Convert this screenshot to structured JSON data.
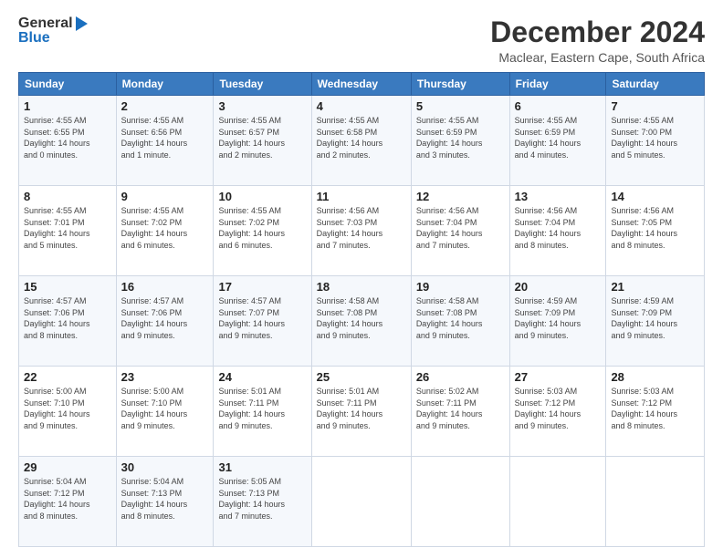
{
  "header": {
    "logo_general": "General",
    "logo_blue": "Blue",
    "main_title": "December 2024",
    "subtitle": "Maclear, Eastern Cape, South Africa"
  },
  "calendar": {
    "days_of_week": [
      "Sunday",
      "Monday",
      "Tuesday",
      "Wednesday",
      "Thursday",
      "Friday",
      "Saturday"
    ],
    "weeks": [
      [
        {
          "day": "1",
          "info": "Sunrise: 4:55 AM\nSunset: 6:55 PM\nDaylight: 14 hours\nand 0 minutes."
        },
        {
          "day": "2",
          "info": "Sunrise: 4:55 AM\nSunset: 6:56 PM\nDaylight: 14 hours\nand 1 minute."
        },
        {
          "day": "3",
          "info": "Sunrise: 4:55 AM\nSunset: 6:57 PM\nDaylight: 14 hours\nand 2 minutes."
        },
        {
          "day": "4",
          "info": "Sunrise: 4:55 AM\nSunset: 6:58 PM\nDaylight: 14 hours\nand 2 minutes."
        },
        {
          "day": "5",
          "info": "Sunrise: 4:55 AM\nSunset: 6:59 PM\nDaylight: 14 hours\nand 3 minutes."
        },
        {
          "day": "6",
          "info": "Sunrise: 4:55 AM\nSunset: 6:59 PM\nDaylight: 14 hours\nand 4 minutes."
        },
        {
          "day": "7",
          "info": "Sunrise: 4:55 AM\nSunset: 7:00 PM\nDaylight: 14 hours\nand 5 minutes."
        }
      ],
      [
        {
          "day": "8",
          "info": "Sunrise: 4:55 AM\nSunset: 7:01 PM\nDaylight: 14 hours\nand 5 minutes."
        },
        {
          "day": "9",
          "info": "Sunrise: 4:55 AM\nSunset: 7:02 PM\nDaylight: 14 hours\nand 6 minutes."
        },
        {
          "day": "10",
          "info": "Sunrise: 4:55 AM\nSunset: 7:02 PM\nDaylight: 14 hours\nand 6 minutes."
        },
        {
          "day": "11",
          "info": "Sunrise: 4:56 AM\nSunset: 7:03 PM\nDaylight: 14 hours\nand 7 minutes."
        },
        {
          "day": "12",
          "info": "Sunrise: 4:56 AM\nSunset: 7:04 PM\nDaylight: 14 hours\nand 7 minutes."
        },
        {
          "day": "13",
          "info": "Sunrise: 4:56 AM\nSunset: 7:04 PM\nDaylight: 14 hours\nand 8 minutes."
        },
        {
          "day": "14",
          "info": "Sunrise: 4:56 AM\nSunset: 7:05 PM\nDaylight: 14 hours\nand 8 minutes."
        }
      ],
      [
        {
          "day": "15",
          "info": "Sunrise: 4:57 AM\nSunset: 7:06 PM\nDaylight: 14 hours\nand 8 minutes."
        },
        {
          "day": "16",
          "info": "Sunrise: 4:57 AM\nSunset: 7:06 PM\nDaylight: 14 hours\nand 9 minutes."
        },
        {
          "day": "17",
          "info": "Sunrise: 4:57 AM\nSunset: 7:07 PM\nDaylight: 14 hours\nand 9 minutes."
        },
        {
          "day": "18",
          "info": "Sunrise: 4:58 AM\nSunset: 7:08 PM\nDaylight: 14 hours\nand 9 minutes."
        },
        {
          "day": "19",
          "info": "Sunrise: 4:58 AM\nSunset: 7:08 PM\nDaylight: 14 hours\nand 9 minutes."
        },
        {
          "day": "20",
          "info": "Sunrise: 4:59 AM\nSunset: 7:09 PM\nDaylight: 14 hours\nand 9 minutes."
        },
        {
          "day": "21",
          "info": "Sunrise: 4:59 AM\nSunset: 7:09 PM\nDaylight: 14 hours\nand 9 minutes."
        }
      ],
      [
        {
          "day": "22",
          "info": "Sunrise: 5:00 AM\nSunset: 7:10 PM\nDaylight: 14 hours\nand 9 minutes."
        },
        {
          "day": "23",
          "info": "Sunrise: 5:00 AM\nSunset: 7:10 PM\nDaylight: 14 hours\nand 9 minutes."
        },
        {
          "day": "24",
          "info": "Sunrise: 5:01 AM\nSunset: 7:11 PM\nDaylight: 14 hours\nand 9 minutes."
        },
        {
          "day": "25",
          "info": "Sunrise: 5:01 AM\nSunset: 7:11 PM\nDaylight: 14 hours\nand 9 minutes."
        },
        {
          "day": "26",
          "info": "Sunrise: 5:02 AM\nSunset: 7:11 PM\nDaylight: 14 hours\nand 9 minutes."
        },
        {
          "day": "27",
          "info": "Sunrise: 5:03 AM\nSunset: 7:12 PM\nDaylight: 14 hours\nand 9 minutes."
        },
        {
          "day": "28",
          "info": "Sunrise: 5:03 AM\nSunset: 7:12 PM\nDaylight: 14 hours\nand 8 minutes."
        }
      ],
      [
        {
          "day": "29",
          "info": "Sunrise: 5:04 AM\nSunset: 7:12 PM\nDaylight: 14 hours\nand 8 minutes."
        },
        {
          "day": "30",
          "info": "Sunrise: 5:04 AM\nSunset: 7:13 PM\nDaylight: 14 hours\nand 8 minutes."
        },
        {
          "day": "31",
          "info": "Sunrise: 5:05 AM\nSunset: 7:13 PM\nDaylight: 14 hours\nand 7 minutes."
        },
        {
          "day": "",
          "info": ""
        },
        {
          "day": "",
          "info": ""
        },
        {
          "day": "",
          "info": ""
        },
        {
          "day": "",
          "info": ""
        }
      ]
    ]
  }
}
